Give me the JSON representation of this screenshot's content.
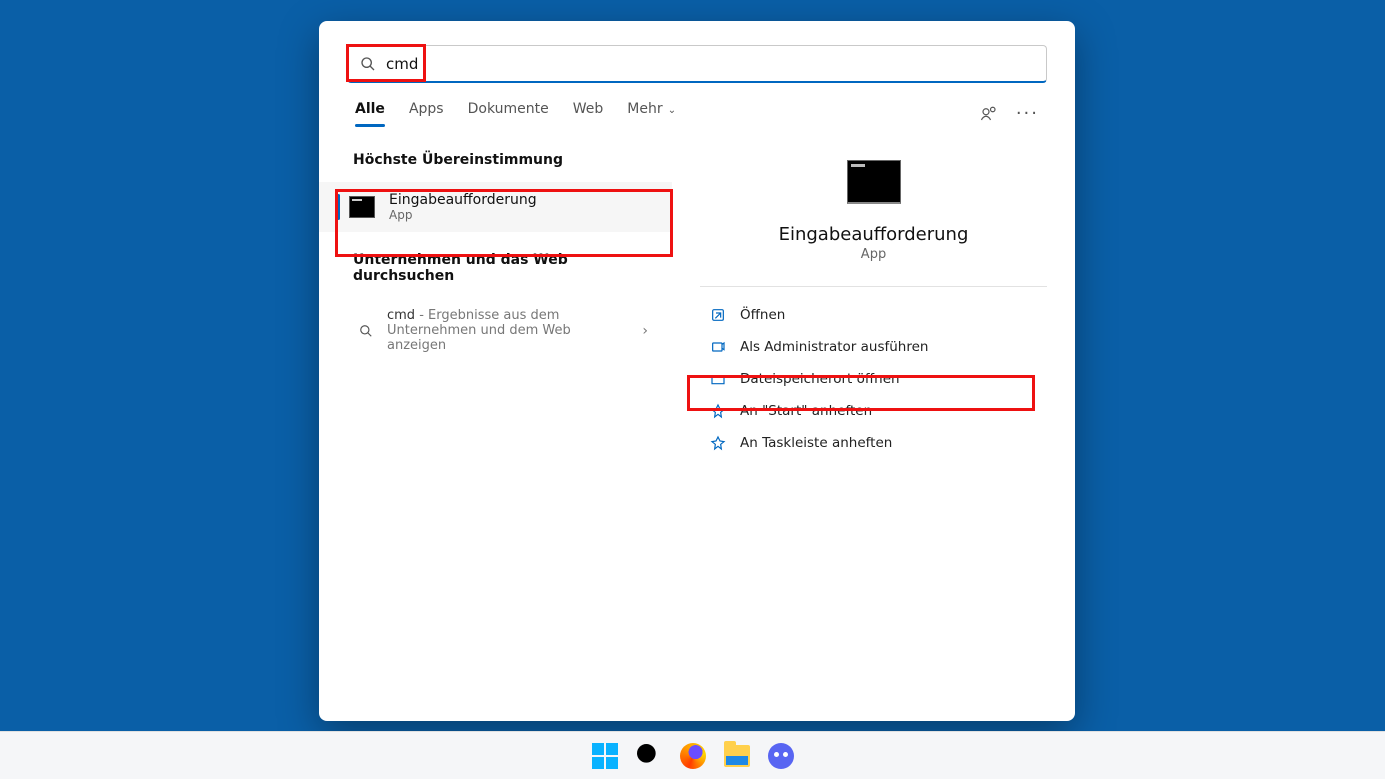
{
  "search": {
    "query": "cmd"
  },
  "tabs": {
    "items": [
      "Alle",
      "Apps",
      "Dokumente",
      "Web",
      "Mehr"
    ],
    "activeIndex": 0
  },
  "left": {
    "bestMatchHeading": "Höchste Übereinstimmung",
    "bestMatch": {
      "title": "Eingabeaufforderung",
      "subtitle": "App"
    },
    "webHeading": "Unternehmen und das Web durchsuchen",
    "webSearch": {
      "term": "cmd",
      "suffix": " - Ergebnisse aus dem Unternehmen und dem Web anzeigen"
    }
  },
  "detail": {
    "title": "Eingabeaufforderung",
    "subtitle": "App",
    "actions": [
      {
        "key": "open",
        "label": "Öffnen"
      },
      {
        "key": "run-admin",
        "label": "Als Administrator ausführen"
      },
      {
        "key": "open-loc",
        "label": "Dateispeicherort öffnen"
      },
      {
        "key": "pin-start",
        "label": "An \"Start\" anheften"
      },
      {
        "key": "pin-taskbar",
        "label": "An Taskleiste anheften"
      }
    ]
  },
  "taskbar": {
    "items": [
      "start",
      "search",
      "firefox",
      "file-explorer",
      "discord"
    ]
  }
}
